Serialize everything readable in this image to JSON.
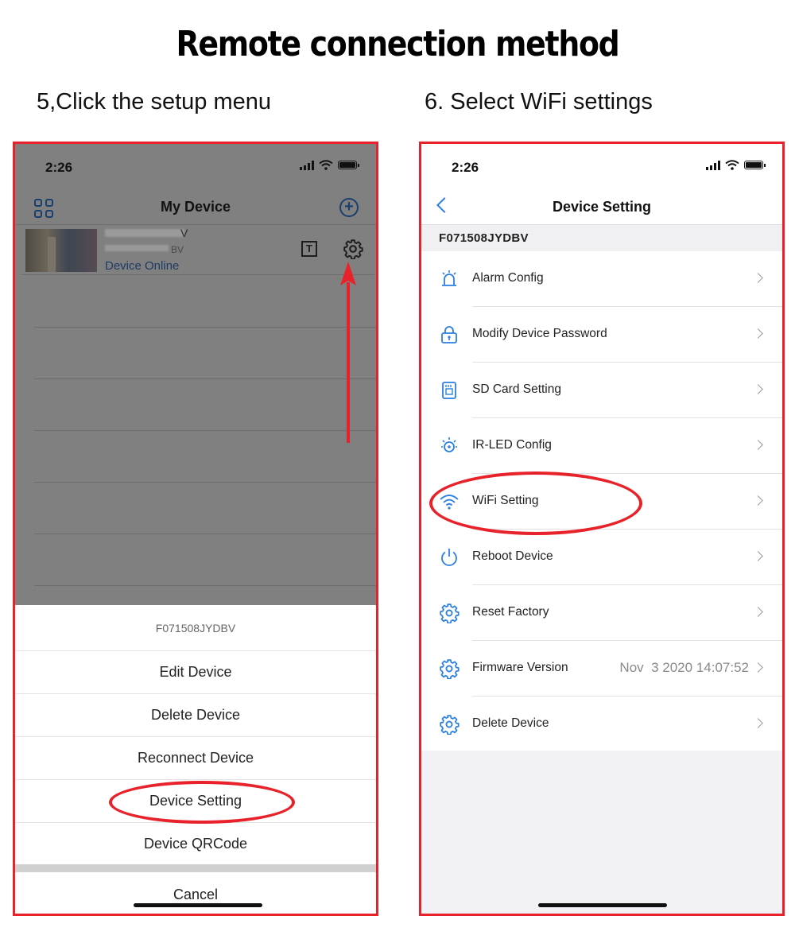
{
  "page": {
    "title": "Remote connection method",
    "step5": "5,Click the setup menu",
    "step6": "6. Select WiFi settings"
  },
  "left_phone": {
    "status_time": "2:26",
    "nav_title": "My Device",
    "device": {
      "name_visible_tail": "V",
      "id_visible_tail": "BV",
      "status": "Device Online"
    },
    "sheet": {
      "header": "F071508JYDBV",
      "items": [
        "Edit Device",
        "Delete Device",
        "Reconnect Device",
        "Device Setting",
        "Device QRCode"
      ],
      "cancel": "Cancel"
    }
  },
  "right_phone": {
    "status_time": "2:26",
    "nav_title": "Device Setting",
    "device_id": "F071508JYDBV",
    "items": [
      {
        "label": "Alarm Config",
        "icon": "alarm-icon",
        "value": ""
      },
      {
        "label": "Modify Device Password",
        "icon": "lock-icon",
        "value": ""
      },
      {
        "label": "SD Card Setting",
        "icon": "sd-card-icon",
        "value": ""
      },
      {
        "label": "IR-LED Config",
        "icon": "ir-led-icon",
        "value": ""
      },
      {
        "label": "WiFi Setting",
        "icon": "wifi-icon",
        "value": ""
      },
      {
        "label": "Reboot Device",
        "icon": "power-icon",
        "value": ""
      },
      {
        "label": "Reset Factory",
        "icon": "gear-icon",
        "value": ""
      },
      {
        "label": "Firmware Version",
        "icon": "gear-icon",
        "value": "Nov  3 2020 14:07:52"
      },
      {
        "label": "Delete Device",
        "icon": "gear-icon",
        "value": ""
      }
    ]
  },
  "colors": {
    "frame_red": "#e8222a",
    "accent_blue": "#2a7fe0",
    "dim_overlay": "#808080"
  }
}
